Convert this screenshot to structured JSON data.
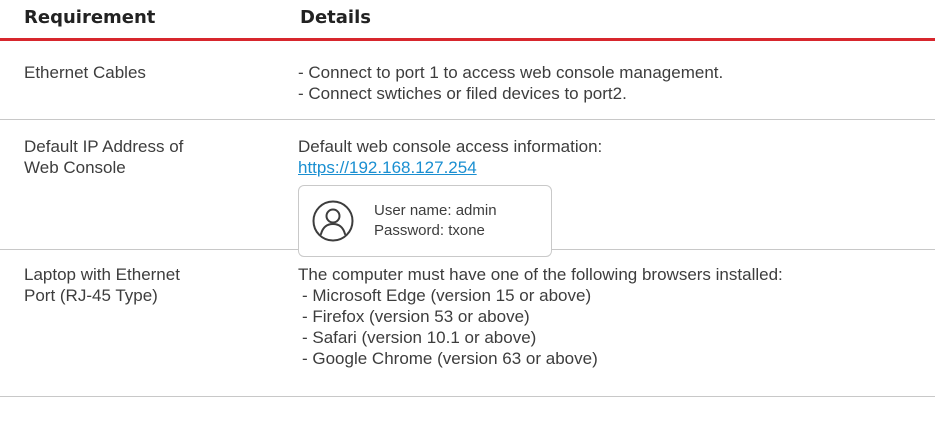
{
  "header": {
    "requirement": "Requirement",
    "details": "Details"
  },
  "rows": [
    {
      "requirement_lines": [
        "Ethernet Cables"
      ],
      "detail_lines": [
        "- Connect to port 1 to access web console management.",
        "- Connect swtiches or filed devices to port2."
      ]
    },
    {
      "requirement_lines": [
        "Default IP Address of",
        "Web Console"
      ],
      "detail_lines": [
        "Default web console access information:"
      ],
      "link": "https://192.168.127.254",
      "credentials": {
        "icon": "user-circle-icon",
        "username": "User name: admin",
        "password": "Password: txone"
      }
    },
    {
      "requirement_lines": [
        "Laptop with Ethernet",
        "Port (RJ-45 Type)"
      ],
      "detail_lines": [
        "The computer must have one of the following browsers installed:",
        "- Microsoft Edge (version 15 or above)",
        "- Firefox (version 53 or above)",
        "- Safari (version 10.1 or above)",
        "- Google Chrome (version 63 or above)"
      ]
    }
  ],
  "colors": {
    "accent": "#d7262d",
    "link": "#1a8fd1",
    "text": "#3d3d3d",
    "divider": "#c8c8c8"
  }
}
